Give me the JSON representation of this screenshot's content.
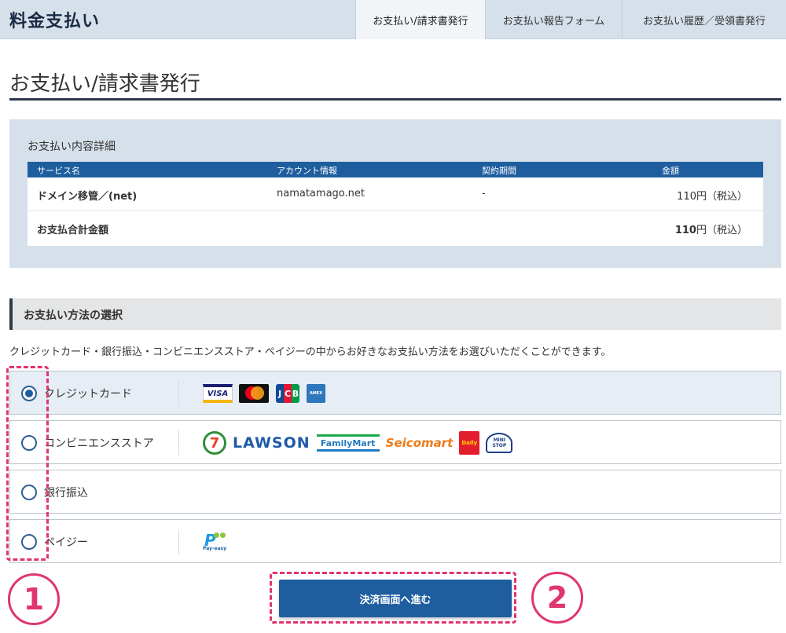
{
  "header": {
    "brand": "料金支払い",
    "tabs": [
      {
        "label": "お支払い/請求書発行",
        "active": true
      },
      {
        "label": "お支払い報告フォーム",
        "active": false
      },
      {
        "label": "お支払い履歴／受領書発行",
        "active": false
      }
    ]
  },
  "page": {
    "title": "お支払い/請求書発行"
  },
  "details": {
    "heading": "お支払い内容詳細",
    "columns": [
      "サービス名",
      "アカウント情報",
      "契約期間",
      "金額"
    ],
    "rows": [
      {
        "service": "ドメイン移管／(net)",
        "account": "namatamago.net",
        "period": "-",
        "amount": "110円（税込）"
      }
    ],
    "total": {
      "label": "お支払合計金額",
      "amount_number": "110",
      "amount_suffix": "円（税込）"
    }
  },
  "payment": {
    "section_title": "お支払い方法の選択",
    "description": "クレジットカード・銀行振込・コンビニエンスストア・ペイジーの中からお好きなお支払い方法をお選びいただくことができます。",
    "methods": [
      {
        "label": "クレジットカード",
        "selected": true,
        "logos": [
          "VISA",
          "Mastercard",
          "JCB",
          "AMEX"
        ]
      },
      {
        "label": "コンビニエンスストア",
        "selected": false,
        "logos": [
          "7",
          "LAWSON",
          "FamilyMart",
          "Seicomart",
          "Daily",
          "MINI STOP"
        ]
      },
      {
        "label": "銀行振込",
        "selected": false,
        "logos": []
      },
      {
        "label": "ペイジー",
        "selected": false,
        "logos": [
          "Pay-easy"
        ]
      }
    ],
    "submit_label": "決済画面へ進む"
  },
  "annotations": {
    "step1": "1",
    "step2": "2"
  },
  "colors": {
    "header_bg": "#d6e0ea",
    "table_header": "#1e5e9f",
    "button": "#1e5e9f",
    "annotation": "#e0356f"
  }
}
